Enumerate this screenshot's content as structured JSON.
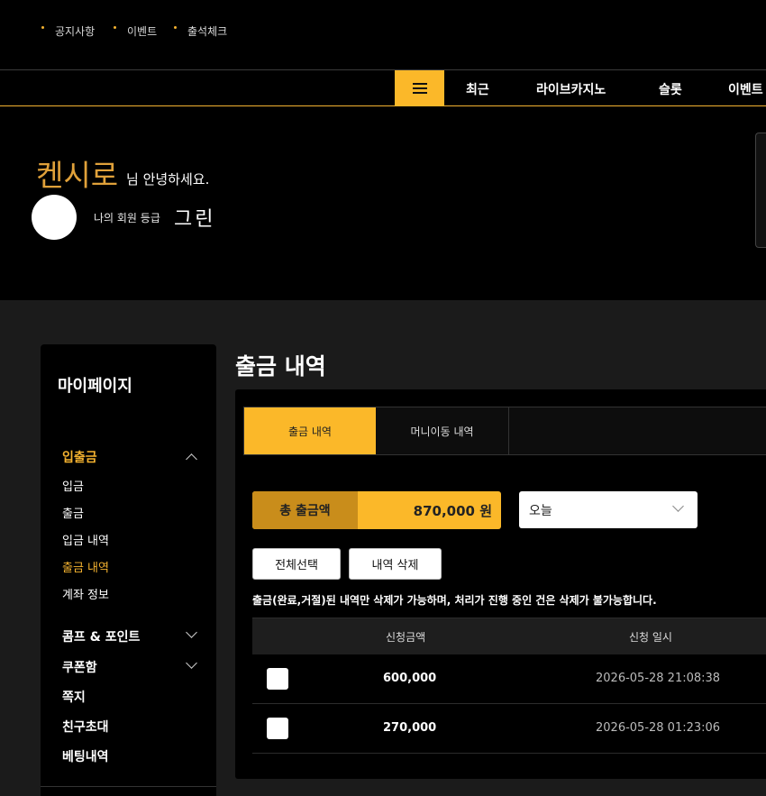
{
  "top_links": [
    "공지사항",
    "이벤트",
    "출석체크"
  ],
  "nav": {
    "menu_icon": "hamburger-icon",
    "items": [
      "최근",
      "라이브카지노",
      "슬롯",
      "이벤트"
    ]
  },
  "profile": {
    "username": "켄시로",
    "greeting": "님 안녕하세요.",
    "grade_label": "나의 회원 등급",
    "grade_value": "그린"
  },
  "sidebar": {
    "title": "마이페이지",
    "sections": [
      {
        "label": "입출금",
        "expanded": true,
        "active": true,
        "items": [
          "입금",
          "출금",
          "입금 내역",
          "출금 내역",
          "계좌 정보"
        ],
        "active_item": "출금 내역"
      },
      {
        "label": "콤프 & 포인트",
        "expanded": false
      },
      {
        "label": "쿠폰함",
        "expanded": false
      },
      {
        "label": "쪽지"
      },
      {
        "label": "친구초대"
      },
      {
        "label": "베팅내역"
      }
    ]
  },
  "content": {
    "title": "출금 내역",
    "tabs": [
      "출금 내역",
      "머니이동 내역"
    ],
    "active_tab": "출금 내역",
    "total_label": "총 출금액",
    "total_amount": "870,000 원",
    "period_select": "오늘",
    "buttons": {
      "select_all": "전체선택",
      "delete": "내역 삭제"
    },
    "notice": "출금(완료,거절)된 내역만 삭제가 가능하며, 처리가 진행 중인 건은 삭제가 불가능합니다.",
    "table": {
      "headers": [
        "신청금액",
        "신청 일시"
      ],
      "rows": [
        {
          "amount": "600,000",
          "date": "2026-05-28 21:08:38"
        },
        {
          "amount": "270,000",
          "date": "2026-05-28 01:23:06"
        }
      ]
    }
  },
  "colors": {
    "accent": "#fbb829",
    "accent_dark": "#c98d1b",
    "username": "#e0a13a"
  }
}
